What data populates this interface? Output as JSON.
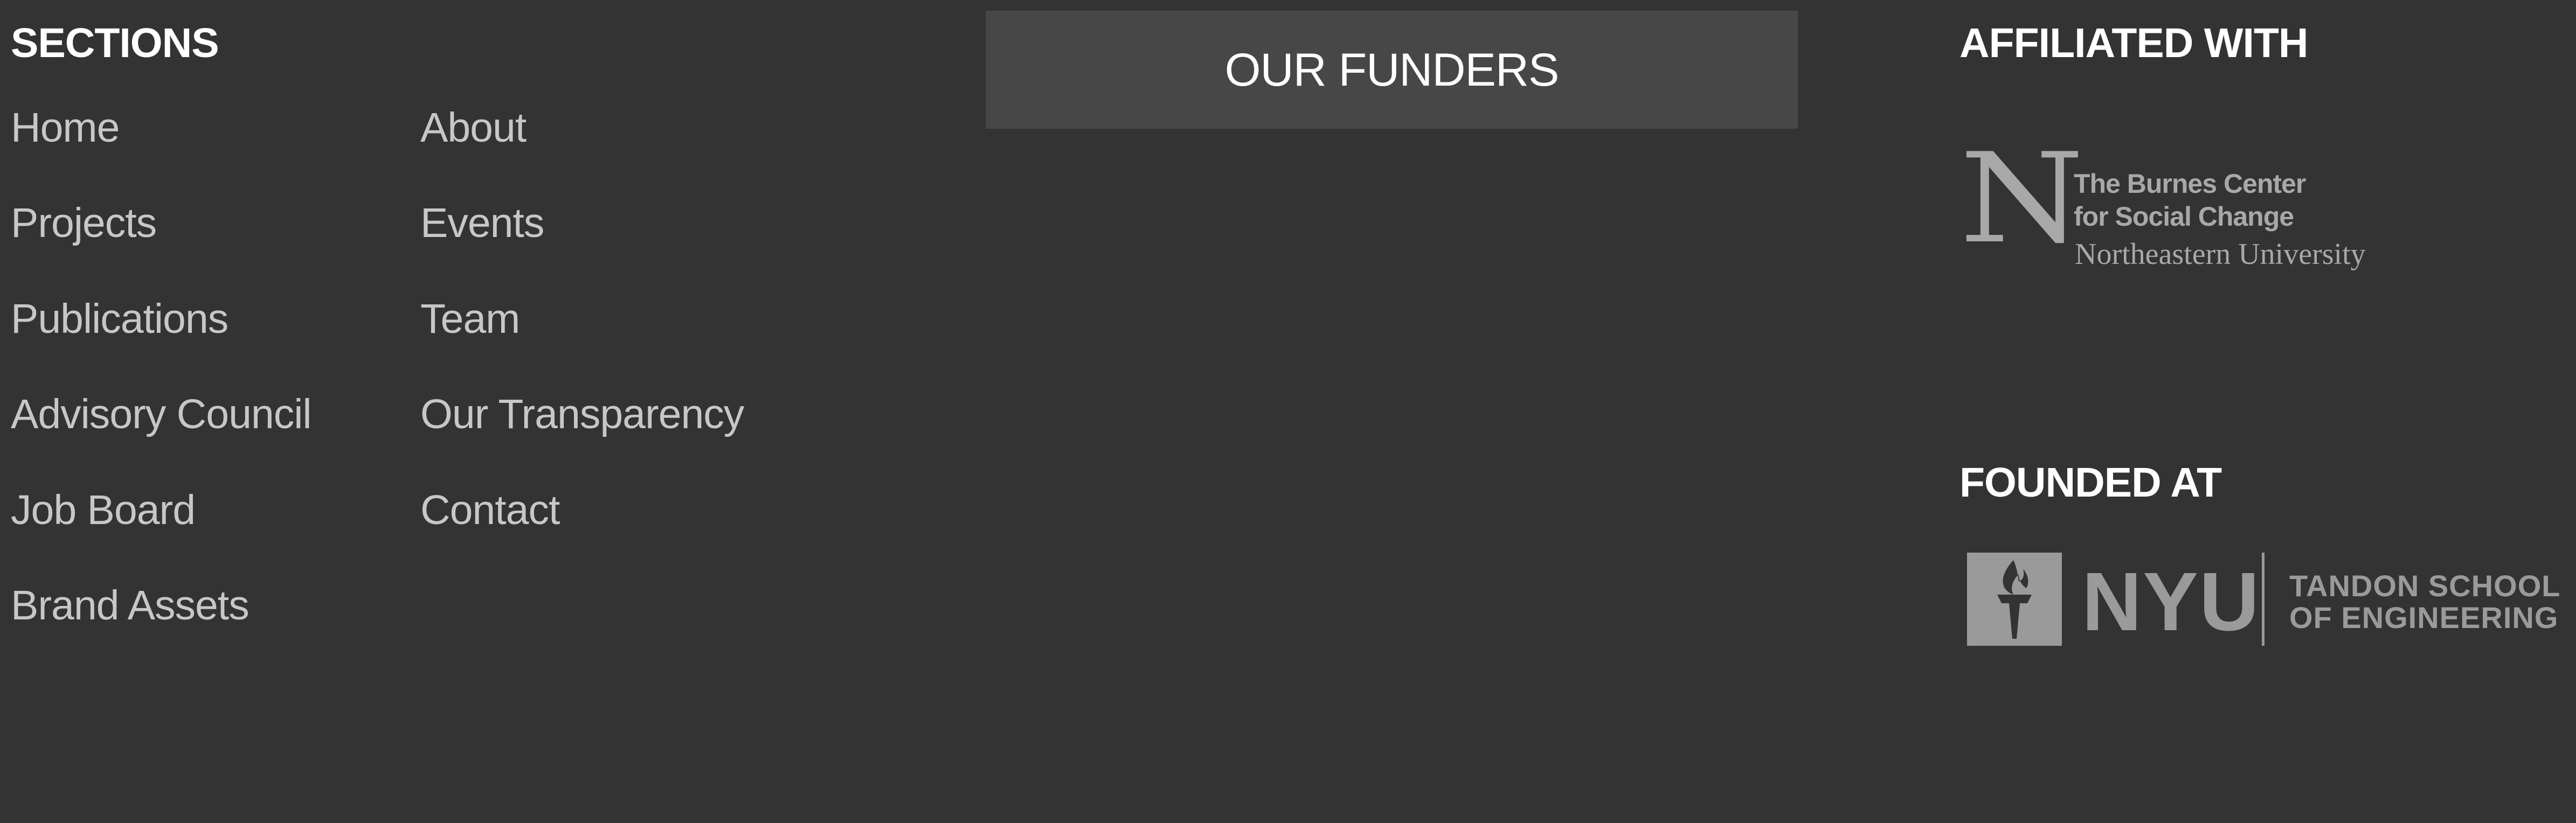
{
  "sections": {
    "heading": "SECTIONS",
    "left_column": [
      "Home",
      "Projects",
      "Publications",
      "Advisory Council",
      "Job Board",
      "Brand Assets"
    ],
    "right_column": [
      "About",
      "Events",
      "Team",
      "Our Transparency",
      "Contact"
    ]
  },
  "funders": {
    "label": "OUR FUNDERS"
  },
  "affiliated": {
    "heading": "AFFILIATED WITH",
    "logo": {
      "icon": "northeastern-n-icon",
      "monogram": "N",
      "line1": "The Burnes Center",
      "line2": "for Social Change",
      "university": "Northeastern University"
    }
  },
  "founded": {
    "heading": "FOUNDED AT",
    "logo": {
      "icon": "nyu-torch-icon",
      "wordmark": "NYU",
      "line1": "TANDON SCHOOL",
      "line2": "OF ENGINEERING"
    }
  },
  "colors": {
    "background": "#333333",
    "heading_text": "#ffffff",
    "link_text": "#c7c7c7",
    "funders_box": "#474747",
    "logo_gray": "#a8a8a8"
  }
}
